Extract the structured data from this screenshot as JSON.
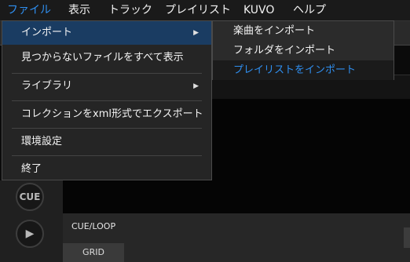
{
  "menubar": {
    "items": [
      "ファイル",
      "表示",
      "トラック",
      "プレイリスト",
      "KUVO",
      "ヘルプ"
    ]
  },
  "file_menu": {
    "import": "インポート",
    "show_missing": "見つからないファイルをすべて表示",
    "library": "ライブラリ",
    "export_xml": "コレクションをxml形式でエクスポート",
    "preferences": "環境設定",
    "exit": "終了"
  },
  "import_submenu": {
    "items": [
      "楽曲をインポート",
      "フォルダをインポート",
      "プレイリストをインポート"
    ]
  },
  "deck": {
    "cue_button": "CUE",
    "play_button": "▶",
    "cue_loop_label": "CUE/LOOP",
    "grid_tab": "GRID"
  },
  "colors": {
    "accent": "#2f8ff0",
    "menu_bg": "#252525",
    "highlight_bg": "#1a3c62"
  }
}
